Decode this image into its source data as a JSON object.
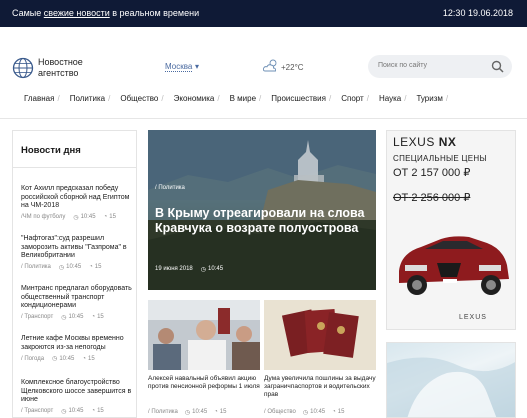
{
  "topbar": {
    "tagline_before": "Самые ",
    "tagline_link": "свежие новости",
    "tagline_after": " в реальном времени",
    "datetime": "12:30 19.06.2018"
  },
  "header": {
    "logo_line1": "Новостное",
    "logo_line2": "агентство",
    "city": "Москва",
    "temperature": "+22°C",
    "search_placeholder": "Поиск по сайту"
  },
  "nav": [
    {
      "label": "Главная"
    },
    {
      "label": "Политика"
    },
    {
      "label": "Общество"
    },
    {
      "label": "Экономика"
    },
    {
      "label": "В мире"
    },
    {
      "label": "Происшествия"
    },
    {
      "label": "Спорт"
    },
    {
      "label": "Наука"
    },
    {
      "label": "Туризм"
    }
  ],
  "news_of_day": {
    "heading": "Новости дня",
    "items": [
      {
        "title": "Кот Ахилл предсказал победу российской сборной над Египтом на ЧМ-2018",
        "rubric": "/ЧМ по футболу",
        "time": "10:45",
        "count": "15"
      },
      {
        "title": "\"Нафтогаз\":суд разрешил заморозить активы \"Газпрома\" в Великобритании",
        "rubric": "/ Политика",
        "time": "10:45",
        "count": "15"
      },
      {
        "title": "Минтранс предлагал оборудовать общественный транспорт кондиционерами",
        "rubric": "/ Транспорт",
        "time": "10:45",
        "count": "15"
      },
      {
        "title": "Летние кафе Москвы временно закроются из-за непогоды",
        "rubric": "/ Погода",
        "time": "10:45",
        "count": "15"
      },
      {
        "title": "Комплексное благоустройство Щелковского шоссе завершится в июне",
        "rubric": "/ Транспорт",
        "time": "10:45",
        "count": "15"
      }
    ]
  },
  "hero": {
    "rubric": "/ Политика",
    "title": "В Крыму отреагировали на слова Кравчука о возрате полуострова",
    "date": "19 июня 2018",
    "time": "10:45"
  },
  "cards": [
    {
      "title": "Алексей навальный объявил акцию против пенсионной реформы 1 июля",
      "rubric": "/ Политика",
      "time": "10:45",
      "count": "15"
    },
    {
      "title": "Дума увеличила пошлины за выдачу заграничпаспортов и водительских прав",
      "rubric": "/ Общество",
      "time": "10:45",
      "count": "15"
    }
  ],
  "ad": {
    "brand_light": "LEXUS ",
    "brand_bold": "NX",
    "special": "СПЕЦИАЛЬНЫЕ ЦЕНЫ",
    "prefix": "ОТ",
    "new_price": "2 157 000 ₽",
    "old_price": "2 256 000 ₽",
    "logo_text": "LEXUS"
  },
  "colors": {
    "topbar": "#0f1a36",
    "accent_link": "#4a6aa0",
    "hero_title": "#ffffff",
    "ad_car": "#8e1b1e"
  }
}
